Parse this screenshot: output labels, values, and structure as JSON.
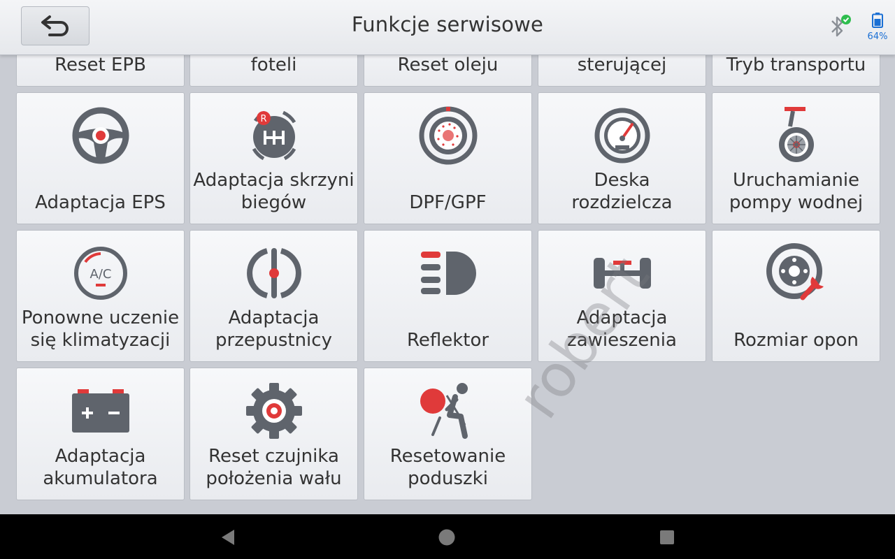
{
  "header": {
    "title": "Funkcje serwisowe",
    "battery": "64%"
  },
  "tiles_top_cut": [
    {
      "label": "Reset EPB"
    },
    {
      "label": "foteli"
    },
    {
      "label": "Reset oleju"
    },
    {
      "label": "sterującej"
    },
    {
      "label": "Tryb transportu"
    }
  ],
  "tiles": [
    {
      "label": "Adaptacja EPS",
      "icon": "steering-wheel-icon"
    },
    {
      "label": "Adaptacja skrzyni biegów",
      "icon": "gearbox-icon"
    },
    {
      "label": "DPF/GPF",
      "icon": "dpf-filter-icon"
    },
    {
      "label": "Deska rozdzielcza",
      "icon": "speedometer-icon"
    },
    {
      "label": "Uruchamianie pompy wodnej",
      "icon": "water-pump-icon"
    },
    {
      "label": "Ponowne uczenie się klimatyzacji",
      "icon": "ac-icon"
    },
    {
      "label": "Adaptacja przepustnicy",
      "icon": "throttle-icon"
    },
    {
      "label": "Reflektor",
      "icon": "headlight-icon"
    },
    {
      "label": "Adaptacja zawieszenia",
      "icon": "suspension-icon"
    },
    {
      "label": "Rozmiar opon",
      "icon": "tire-wrench-icon"
    },
    {
      "label": "Adaptacja akumulatora",
      "icon": "battery-icon"
    },
    {
      "label": "Reset czujnika położenia wału",
      "icon": "gear-sensor-icon"
    },
    {
      "label": "Resetowanie poduszki",
      "icon": "airbag-icon"
    }
  ],
  "watermark": "robert",
  "colors": {
    "accent": "#e03a3a",
    "icon_gray": "#5f646c"
  }
}
